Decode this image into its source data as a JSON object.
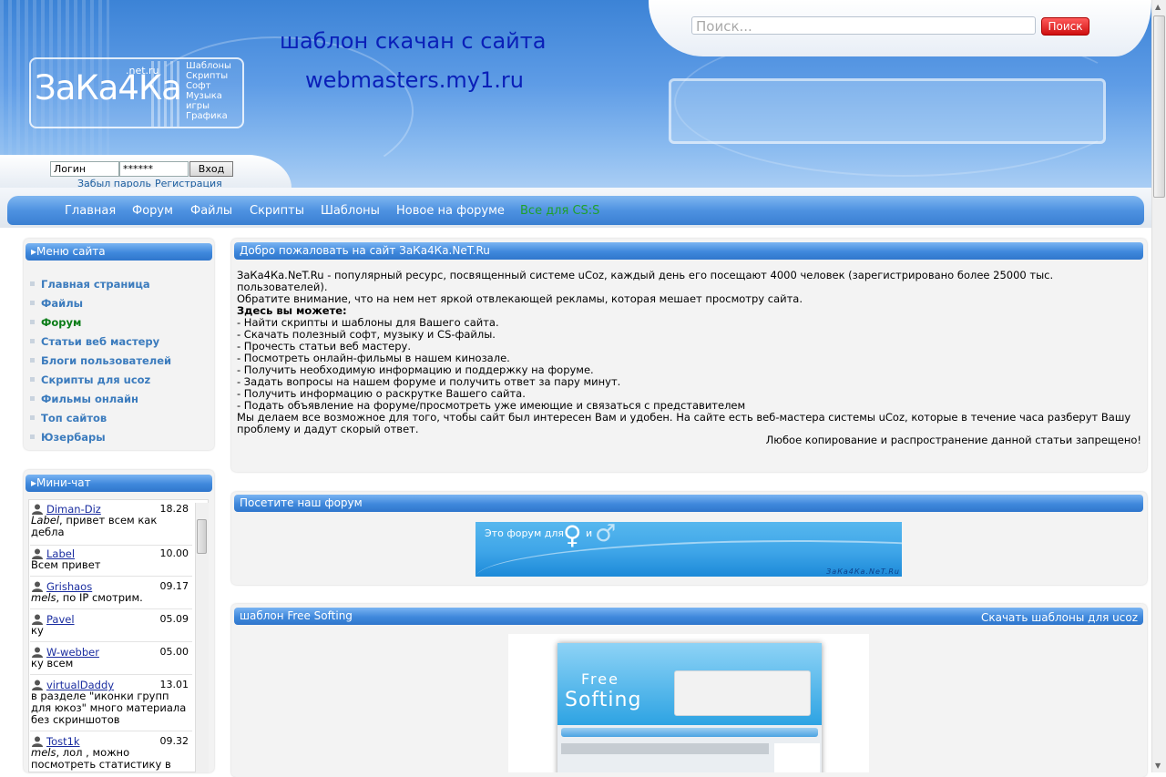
{
  "header": {
    "search_placeholder": "Поиск...",
    "search_button": "Поиск",
    "logo": {
      "main": "ЗаКа4Ка",
      "net": ".net.ru",
      "menu": [
        "Шаблоны",
        "Скрипты",
        "Софт",
        "Музыка",
        "игры",
        "Графика"
      ]
    },
    "site_text_1": "шаблон скачан с сайта",
    "site_text_2": "webmasters.my1.ru",
    "login_value": "Логин",
    "password_value": "******",
    "login_button": "Вход",
    "forgot_password": "Забыл пароль",
    "register": "Регистрация"
  },
  "nav": {
    "items": [
      "Главная",
      "Форум",
      "Файлы",
      "Скрипты",
      "Шаблоны",
      "Новое на форуме"
    ],
    "special": "Все для CS:S",
    "special_color": "#1fa12a"
  },
  "site_menu": {
    "title": "Меню сайта",
    "items": [
      "Главная страница",
      "Файлы",
      "Форум",
      "Статьи веб мастеру",
      "Блоги пользователей",
      "Скрипты для ucoz",
      "Фильмы онлайн",
      "Топ сайтов",
      "Юзербары"
    ],
    "active_index": 2
  },
  "mini_chat": {
    "title": "Мини-чат",
    "messages": [
      {
        "user": "Diman-Diz",
        "time": "18.28",
        "mention": "Label",
        "text": ", привет всем как дебла"
      },
      {
        "user": "Label",
        "time": "10.00",
        "mention": "",
        "text": "Всем привет"
      },
      {
        "user": "Grishaos",
        "time": "09.17",
        "mention": "mels",
        "text": ", по IP смотрим."
      },
      {
        "user": "Pavel",
        "time": "05.09",
        "mention": "",
        "text": "ку"
      },
      {
        "user": "W-webber",
        "time": "05.00",
        "mention": "",
        "text": "ку всем"
      },
      {
        "user": "virtualDaddy",
        "time": "13.01",
        "mention": "",
        "text": "в разделе \"иконки групп для юкоз\" много материала без скриншотов"
      },
      {
        "user": "Tost1k",
        "time": "09.32",
        "mention": "mels",
        "text": ", лол , можно посмотреть статистику в"
      }
    ]
  },
  "welcome": {
    "title": "Добро пожаловать на сайт ЗаКа4Ка.NeT.Ru",
    "lines": [
      "ЗаКа4Ка.NeT.Ru - популярный ресурс, посвященный системе uCoz, каждый день его посещают 4000 человек (зарегистрировано более 25000 тыс. пользователей).",
      "Обратите внимание, что на нем нет яркой отвлекающей рекламы, которая мешает просмотру сайта."
    ],
    "subheading": "Здесь вы можете:",
    "bullets": [
      "- Найти скрипты и шаблоны для Вашего сайта.",
      "- Скачать полезный софт, музыку и CS-файлы.",
      "- Прочесть статьи веб мастеру.",
      "- Посмотреть онлайн-фильмы в нашем кинозале.",
      "- Получить необходимую информацию и поддержку на форуме.",
      "- Задать вопросы на нашем форуме и получить ответ за пару минут.",
      "- Получить информацию о раскрутке Вашего сайта.",
      "- Подать объявление на форуме/просмотреть уже имеющие и связаться с представителем"
    ],
    "closing": "Мы делаем все возможное для того, чтобы сайт был интересен Вам и удобен. На сайте есть веб-мастера системы uCoz, которые в течение часа разберут Вашу проблему и дадут скорый ответ.",
    "copy_note": "Любое копирование и распространение данной статьи запрещено!"
  },
  "forum_block": {
    "title": "Посетите наш форум",
    "banner_text": "Это форум для",
    "banner_and": "и",
    "banner_logo": "ЗаКа4Ка.NeT.Ru"
  },
  "template_block": {
    "title": "шаблон Free Softing",
    "link": "Скачать шаблоны для ucoz",
    "preview_title_1": "Free",
    "preview_title_2": "Softing"
  }
}
